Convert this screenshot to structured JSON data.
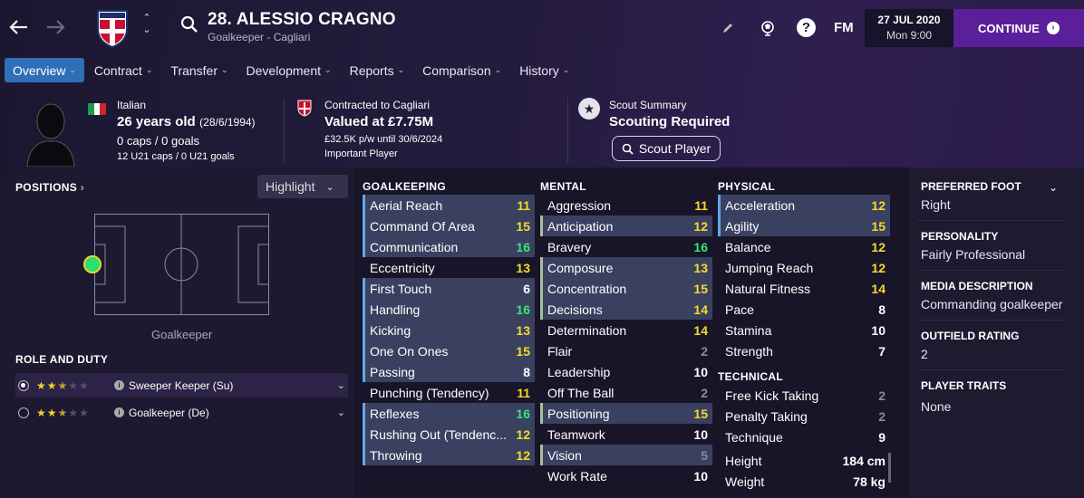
{
  "player": {
    "title": "28. ALESSIO CRAGNO",
    "subtitle": "Goalkeeper - Cagliari",
    "nationality": "Italian",
    "age": "26 years old",
    "dob": "(28/6/1994)",
    "caps": "0 caps / 0 goals",
    "u21_caps": "12 U21 caps / 0 U21 goals"
  },
  "topbar": {
    "game_label": "FM",
    "date": "27 JUL 2020",
    "day_time": "Mon 9:00",
    "continue_label": "CONTINUE"
  },
  "tabs": [
    {
      "label": "Overview"
    },
    {
      "label": "Contract"
    },
    {
      "label": "Transfer"
    },
    {
      "label": "Development"
    },
    {
      "label": "Reports"
    },
    {
      "label": "Comparison"
    },
    {
      "label": "History"
    }
  ],
  "contract": {
    "line1": "Contracted to Cagliari",
    "value": "Valued at £7.75M",
    "wage": "£32.5K p/w until 30/6/2024",
    "status": "Important Player"
  },
  "scout": {
    "label": "Scout Summary",
    "status": "Scouting Required",
    "button": "Scout Player"
  },
  "positions": {
    "heading": "POSITIONS",
    "highlight": "Highlight",
    "position_label": "Goalkeeper"
  },
  "roles": {
    "heading": "ROLE AND DUTY",
    "items": [
      {
        "label": "Sweeper Keeper (Su)",
        "stars": 2.5,
        "selected": true
      },
      {
        "label": "Goalkeeper (De)",
        "stars": 2.5,
        "selected": false
      }
    ]
  },
  "attributes": {
    "goalkeeping": {
      "heading": "GOALKEEPING",
      "items": [
        {
          "name": "Aerial Reach",
          "value": "11"
        },
        {
          "name": "Command Of Area",
          "value": "15"
        },
        {
          "name": "Communication",
          "value": "16"
        },
        {
          "name": "Eccentricity",
          "value": "13"
        },
        {
          "name": "First Touch",
          "value": "6"
        },
        {
          "name": "Handling",
          "value": "16"
        },
        {
          "name": "Kicking",
          "value": "13"
        },
        {
          "name": "One On Ones",
          "value": "15"
        },
        {
          "name": "Passing",
          "value": "8"
        },
        {
          "name": "Punching (Tendency)",
          "value": "11"
        },
        {
          "name": "Reflexes",
          "value": "16"
        },
        {
          "name": "Rushing Out (Tendenc...",
          "value": "12"
        },
        {
          "name": "Throwing",
          "value": "12"
        }
      ]
    },
    "mental": {
      "heading": "MENTAL",
      "items": [
        {
          "name": "Aggression",
          "value": "11"
        },
        {
          "name": "Anticipation",
          "value": "12"
        },
        {
          "name": "Bravery",
          "value": "16"
        },
        {
          "name": "Composure",
          "value": "13"
        },
        {
          "name": "Concentration",
          "value": "15"
        },
        {
          "name": "Decisions",
          "value": "14"
        },
        {
          "name": "Determination",
          "value": "14"
        },
        {
          "name": "Flair",
          "value": "2"
        },
        {
          "name": "Leadership",
          "value": "10"
        },
        {
          "name": "Off The Ball",
          "value": "2"
        },
        {
          "name": "Positioning",
          "value": "15"
        },
        {
          "name": "Teamwork",
          "value": "10"
        },
        {
          "name": "Vision",
          "value": "5"
        },
        {
          "name": "Work Rate",
          "value": "10"
        }
      ]
    },
    "physical": {
      "heading": "PHYSICAL",
      "items": [
        {
          "name": "Acceleration",
          "value": "12"
        },
        {
          "name": "Agility",
          "value": "15"
        },
        {
          "name": "Balance",
          "value": "12"
        },
        {
          "name": "Jumping Reach",
          "value": "12"
        },
        {
          "name": "Natural Fitness",
          "value": "14"
        },
        {
          "name": "Pace",
          "value": "8"
        },
        {
          "name": "Stamina",
          "value": "10"
        },
        {
          "name": "Strength",
          "value": "7"
        }
      ]
    },
    "technical": {
      "heading": "TECHNICAL",
      "items": [
        {
          "name": "Free Kick Taking",
          "value": "2"
        },
        {
          "name": "Penalty Taking",
          "value": "2"
        },
        {
          "name": "Technique",
          "value": "9"
        }
      ]
    },
    "measurements": [
      {
        "name": "Height",
        "value": "184 cm"
      },
      {
        "name": "Weight",
        "value": "78 kg"
      }
    ]
  },
  "details": {
    "preferred_foot_label": "PREFERRED FOOT",
    "preferred_foot": "Right",
    "personality_label": "PERSONALITY",
    "personality": "Fairly Professional",
    "media_label": "MEDIA DESCRIPTION",
    "media": "Commanding goalkeeper",
    "outfield_label": "OUTFIELD RATING",
    "outfield": "2",
    "traits_label": "PLAYER TRAITS",
    "traits": "None"
  },
  "colors": {
    "accent": "#5c1f9a",
    "tab_active": "#2f6fb8",
    "high": "#32e876",
    "mid": "#f2dd2b",
    "low": "#8d899a"
  }
}
